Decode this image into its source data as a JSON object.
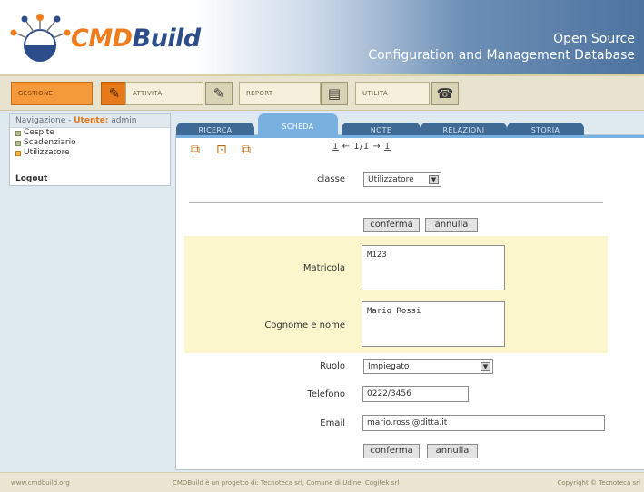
{
  "header": {
    "brand_part1": "CMD",
    "brand_part2": "Build",
    "tagline_line1": "Open Source",
    "tagline_line2": "Configuration and Management Database"
  },
  "menu": {
    "items": [
      {
        "label": "GESTIONE",
        "icon": "pencil-icon",
        "active": true
      },
      {
        "label": "ATTIVITÀ",
        "icon": "pencil-icon",
        "active": false
      },
      {
        "label": "REPORT",
        "icon": "report-icon",
        "active": false
      },
      {
        "label": "UTILITÀ",
        "icon": "telephone-icon",
        "active": false
      }
    ]
  },
  "nav": {
    "title": "Navigazione - ",
    "user_label": "Utente:",
    "user_name": " admin",
    "tree": [
      "Cespite",
      "Scadenziario",
      "Utilizzatore"
    ],
    "selected": "Utilizzatore",
    "logout": "Logout"
  },
  "tabs": [
    "RICERCA",
    "SCHEDA",
    "NOTE",
    "RELAZIONI",
    "STORIA"
  ],
  "active_tab": "SCHEDA",
  "pager": {
    "first": "1",
    "prev": "←",
    "current": "1/1",
    "next": "→",
    "last": "1"
  },
  "form": {
    "classe_label": "classe",
    "classe_value": "Utilizzatore",
    "confirm_label": "conferma",
    "cancel_label": "annulla",
    "matricola_label": "Matricola",
    "matricola_value": "M123",
    "cognome_label": "Cognome e nome",
    "cognome_value": "Mario Rossi",
    "ruolo_label": "Ruolo",
    "ruolo_value": "Impiegato",
    "telefono_label": "Telefono",
    "telefono_value": "0222/3456",
    "email_label": "Email",
    "email_value": "mario.rossi@ditta.it"
  },
  "footer": {
    "left": "www.cmdbuild.org",
    "center": "CMDBuild è un progetto di: Tecnoteca srl, Comune di Udine, Cogitek srl",
    "right": "Copyright © Tecnoteca srl"
  },
  "colors": {
    "accent_orange": "#f07c1e",
    "brand_blue": "#2d4d8a",
    "tab_blue": "#3f6a96",
    "active_tab": "#78b1e0",
    "form_band": "#fbf6cc"
  }
}
